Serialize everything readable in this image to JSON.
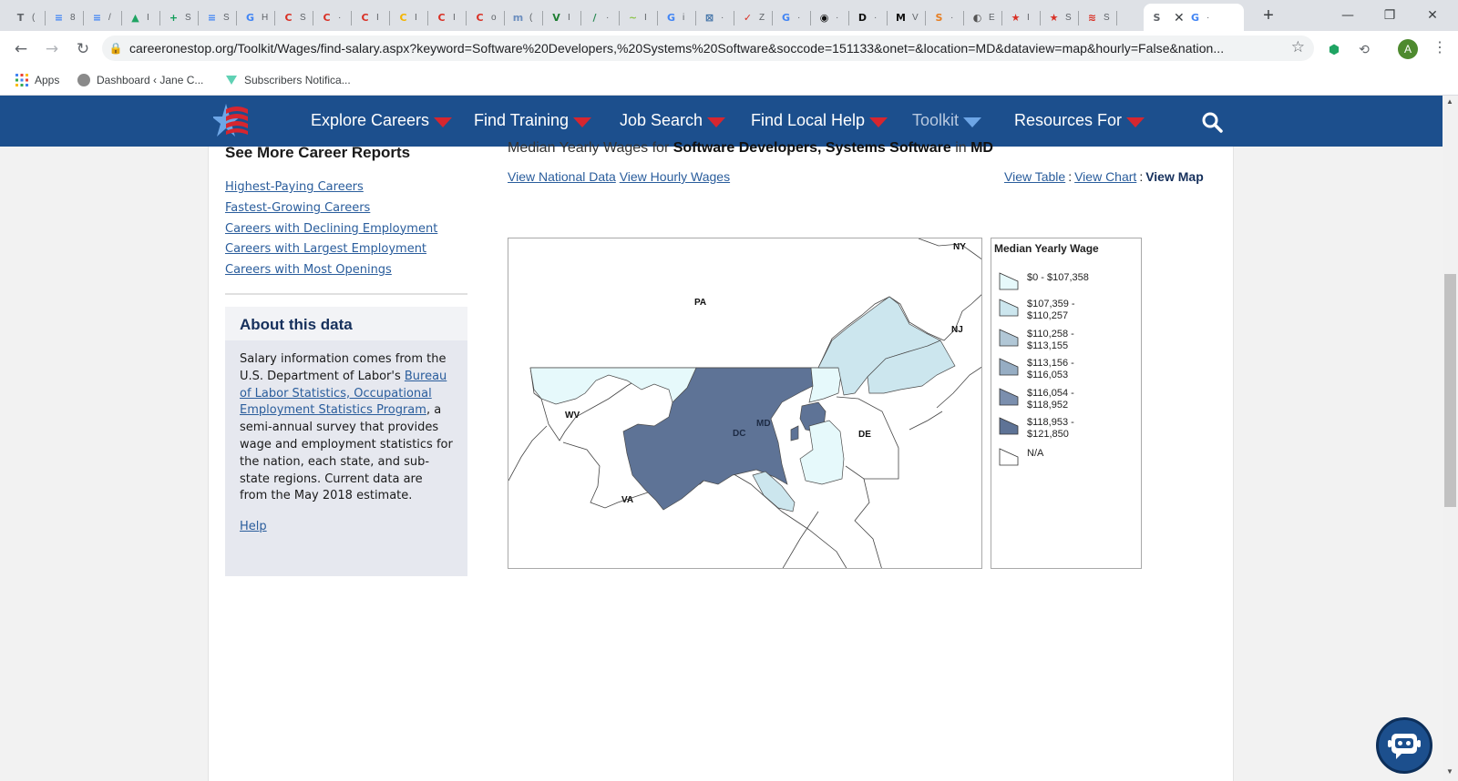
{
  "browser": {
    "tabs": [
      {
        "glyph": "T",
        "label": "(",
        "color": "#5f6368"
      },
      {
        "glyph": "≡",
        "label": "8",
        "color": "#4285f4"
      },
      {
        "glyph": "≡",
        "label": "/",
        "color": "#4285f4"
      },
      {
        "glyph": "▲",
        "label": "I",
        "color": "#1fa463"
      },
      {
        "glyph": "+",
        "label": "S",
        "color": "#0f9d58"
      },
      {
        "glyph": "≡",
        "label": "S",
        "color": "#4285f4"
      },
      {
        "glyph": "G",
        "label": "H",
        "color": "#4285f4"
      },
      {
        "glyph": "C",
        "label": "S",
        "color": "#d93025"
      },
      {
        "glyph": "C",
        "label": "·",
        "color": "#d93025"
      },
      {
        "glyph": "C",
        "label": "I",
        "color": "#d93025"
      },
      {
        "glyph": "C",
        "label": "I",
        "color": "#f4b400"
      },
      {
        "glyph": "C",
        "label": "I",
        "color": "#d93025"
      },
      {
        "glyph": "C",
        "label": "o",
        "color": "#d93025"
      },
      {
        "glyph": "m",
        "label": "(",
        "color": "#6c8ebf"
      },
      {
        "glyph": "V",
        "label": "I",
        "color": "#1e7d32"
      },
      {
        "glyph": "/",
        "label": "·",
        "color": "#2e8b57"
      },
      {
        "glyph": "~",
        "label": "I",
        "color": "#8bc34a"
      },
      {
        "glyph": "G",
        "label": "i",
        "color": "#4285f4"
      },
      {
        "glyph": "⊠",
        "label": "·",
        "color": "#3b6ea5"
      },
      {
        "glyph": "✓",
        "label": "Z",
        "color": "#d93025"
      },
      {
        "glyph": "G",
        "label": "·",
        "color": "#4285f4"
      },
      {
        "glyph": "◉",
        "label": "·",
        "color": "#111"
      },
      {
        "glyph": "D",
        "label": "·",
        "color": "#111"
      },
      {
        "glyph": "M",
        "label": "V",
        "color": "#111"
      },
      {
        "glyph": "S",
        "label": "·",
        "color": "#e67e22"
      },
      {
        "glyph": "◐",
        "label": "E",
        "color": "#555"
      },
      {
        "glyph": "★",
        "label": "I",
        "color": "#d93025"
      },
      {
        "glyph": "★",
        "label": "S",
        "color": "#d93025"
      },
      {
        "glyph": "≋",
        "label": "S",
        "color": "#d93025"
      }
    ],
    "active_tab": {
      "glyph": "S",
      "close": "✕"
    },
    "after_tab": {
      "glyph": "G",
      "label": "·"
    },
    "url": "careeronestop.org/Toolkit/Wages/find-salary.aspx?keyword=Software%20Developers,%20Systems%20Software&soccode=151133&onet=&location=MD&dataview=map&hourly=False&nation...",
    "avatar_letter": "A",
    "bookmarks": {
      "apps": "Apps",
      "dashboard": "Dashboard ‹ Jane C...",
      "subscribers": "Subscribers Notifica..."
    }
  },
  "nav": {
    "explore": "Explore Careers",
    "training": "Find Training",
    "jobs": "Job Search",
    "local": "Find Local Help",
    "toolkit": "Toolkit",
    "resources": "Resources For"
  },
  "sidebar": {
    "title": "See More Career Reports",
    "links": [
      "Highest-Paying Careers",
      "Fastest-Growing Careers",
      "Careers with Declining Employment",
      "Careers with Largest Employment",
      "Careers with Most Openings"
    ],
    "about": {
      "title": "About this data",
      "text_1": "Salary information comes from the U.S. Department of Labor's ",
      "link": "Bureau of Labor Statistics, Occupational Employment Statistics Program",
      "text_2": ", a semi-annual survey that provides wage and employment statistics for the nation, each state, and sub-state regions. Current data are from the May 2018 estimate.",
      "help": "Help"
    }
  },
  "main": {
    "title_prefix": "Median Yearly Wages for ",
    "title_occupation": "Software Developers, Systems Software",
    "title_mid": " in ",
    "title_state": "MD",
    "view_national": "View National Data",
    "view_hourly": "View Hourly Wages",
    "view_table": "View Table",
    "view_chart": "View Chart",
    "view_map": "View Map",
    "separator": ":"
  },
  "map": {
    "labels": {
      "ny": "NY",
      "pa": "PA",
      "nj": "NJ",
      "wv": "WV",
      "md": "MD",
      "dc": "DC",
      "de": "DE",
      "va": "VA"
    },
    "colors": {
      "c0": "#e6f9fb",
      "c1": "#cce6ee",
      "c2": "#b1c7d6",
      "c3": "#96adc3",
      "c4": "#7b8fae",
      "c5": "#5e7396",
      "na": "#ffffff"
    }
  },
  "legend": {
    "title": "Median Yearly Wage",
    "items": [
      {
        "l1": "$0 - $107,358",
        "l2": ""
      },
      {
        "l1": "$107,359 -",
        "l2": "$110,257"
      },
      {
        "l1": "$110,258 -",
        "l2": "$113,155"
      },
      {
        "l1": "$113,156 -",
        "l2": "$116,053"
      },
      {
        "l1": "$116,054 -",
        "l2": "$118,952"
      },
      {
        "l1": "$118,953 -",
        "l2": "$121,850"
      },
      {
        "l1": "N/A",
        "l2": ""
      }
    ]
  }
}
